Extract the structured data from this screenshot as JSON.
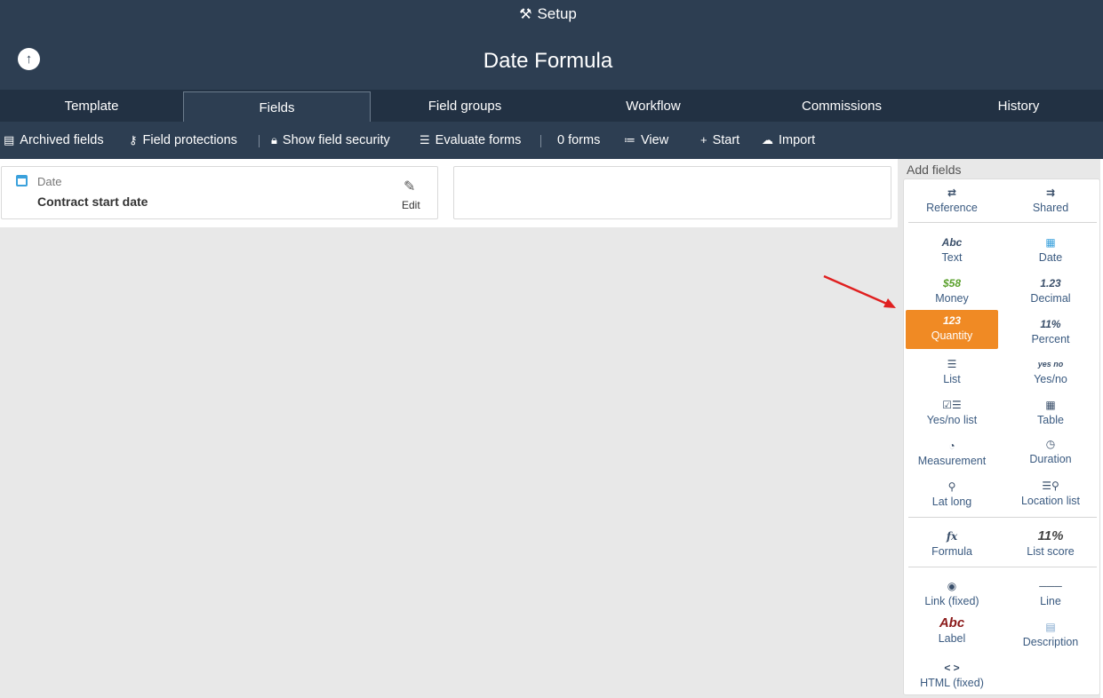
{
  "header": {
    "setup_label": "Setup",
    "title": "Date Formula",
    "up_icon": "arrow-up-circle-icon"
  },
  "tabs": [
    {
      "label": "Template"
    },
    {
      "label": "Fields"
    },
    {
      "label": "Field groups"
    },
    {
      "label": "Workflow"
    },
    {
      "label": "Commissions"
    },
    {
      "label": "History"
    }
  ],
  "active_tab": "Fields",
  "toolbar": {
    "archived": "Archived fields",
    "protections": "Field protections",
    "security": "Show field security",
    "evaluate": "Evaluate forms",
    "forms_count": "0 forms",
    "view": "View",
    "start": "Start",
    "import": "Import"
  },
  "field_card": {
    "type_label": "Date",
    "name": "Contract start date",
    "edit_label": "Edit"
  },
  "panel": {
    "title": "Add fields",
    "fields": {
      "reference": "Reference",
      "shared": "Shared",
      "text": "Text",
      "date": "Date",
      "money": "Money",
      "decimal": "Decimal",
      "quantity": "Quantity",
      "percent": "Percent",
      "list": "List",
      "yesno": "Yes/no",
      "yesno_list": "Yes/no list",
      "table": "Table",
      "measurement": "Measurement",
      "duration": "Duration",
      "latlong": "Lat long",
      "location_list": "Location list",
      "formula": "Formula",
      "list_score": "List score",
      "link_fixed": "Link (fixed)",
      "line": "Line",
      "label": "Label",
      "description": "Description",
      "html_fixed": "HTML (fixed)"
    },
    "icons": {
      "text_icon": "Abc",
      "money_icon": "$58",
      "decimal_icon": "1.23",
      "quantity_icon": "123",
      "percent_icon": "11%",
      "yesno_icon": "yes no",
      "formula_icon": "fx",
      "list_score_icon": "11%",
      "label_icon": "Abc"
    },
    "active_field": "Quantity"
  },
  "colors": {
    "header_bg": "#2d3e52",
    "tabs_bg": "#223143",
    "accent": "#f08a24",
    "arrow": "#e02020"
  }
}
